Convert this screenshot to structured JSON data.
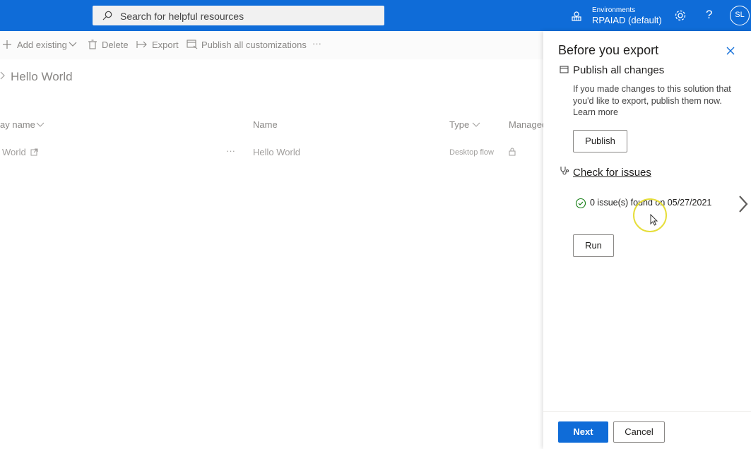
{
  "header": {
    "search_placeholder": "Search for helpful resources",
    "env_label": "Environments",
    "env_value": "RPAIAD (default)",
    "avatar_initials": "SL",
    "help_glyph": "?"
  },
  "commands": {
    "add_existing": "Add existing",
    "delete": "Delete",
    "export": "Export",
    "publish_all": "Publish all customizations",
    "more": "···"
  },
  "page": {
    "title": "Hello World"
  },
  "table": {
    "columns": {
      "display_name": "ay name",
      "name": "Name",
      "type": "Type",
      "managed": "Managed"
    },
    "row": {
      "display_name": "World",
      "more": "···",
      "name": "Hello World",
      "type": "Desktop flow"
    }
  },
  "panel": {
    "title": "Before you export",
    "publish_section": {
      "heading": "Publish all changes",
      "description": "If you made changes to this solution that you'd like to export, publish them now.",
      "learn_more": "Learn more",
      "button": "Publish"
    },
    "check_section": {
      "heading": "Check for issues",
      "status": "0 issue(s) found on 05/27/2021",
      "button": "Run"
    },
    "footer": {
      "next": "Next",
      "cancel": "Cancel"
    }
  },
  "colors": {
    "accent": "#0f6cd8",
    "success": "#107c10",
    "highlight": "#e6de3a"
  },
  "icons": [
    "search-icon",
    "environment-icon",
    "gear-icon",
    "help-icon",
    "plus-icon",
    "chevron-down-icon",
    "trash-icon",
    "export-arrow-icon",
    "publish-icon",
    "chevron-right-icon",
    "open-external-icon",
    "lock-icon",
    "close-icon",
    "stethoscope-icon",
    "check-circle-icon"
  ]
}
